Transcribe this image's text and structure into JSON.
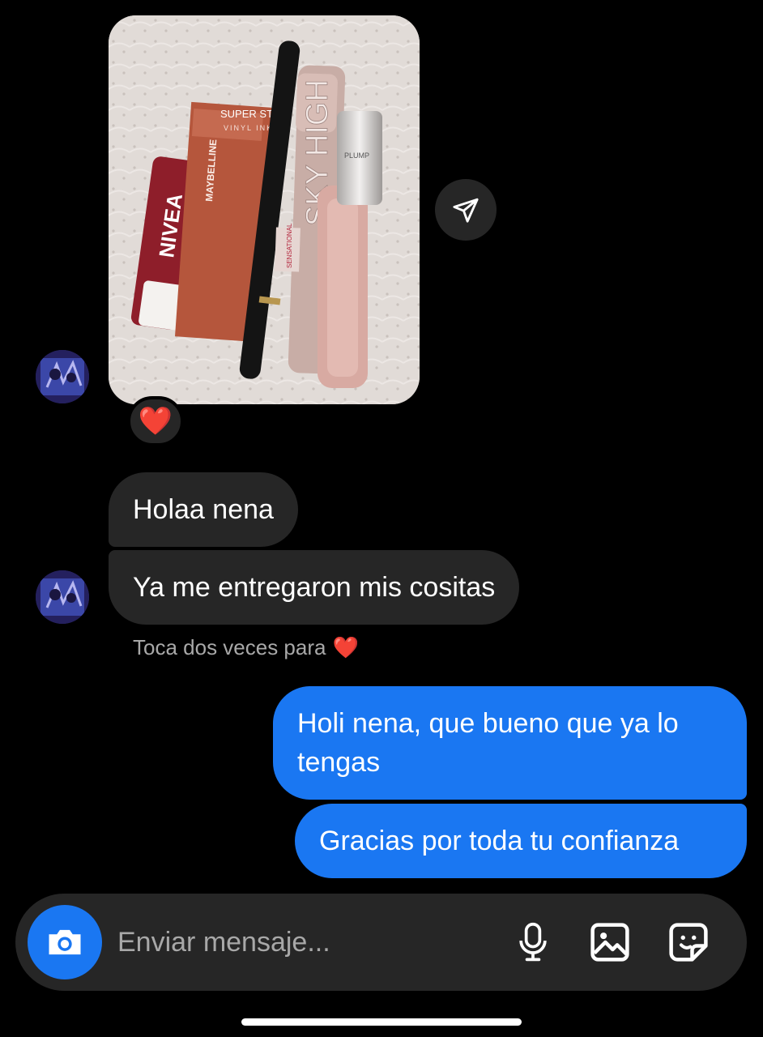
{
  "thread": {
    "photo_message": {
      "image_alt": "Foto de productos de maquillaje",
      "reaction": "❤️",
      "labels": {
        "nivea": "NIVEA",
        "maybelline_top": "SUPER STAY",
        "maybelline_sub": "VINYL INK",
        "maybelline_side": "MAYBELLINE",
        "sky_high": "SKY HIGH",
        "sensational": "SENSATIONAL",
        "gloss": "PLUMP"
      }
    },
    "incoming": [
      {
        "text": "Holaa nena"
      },
      {
        "text": "Ya me entregaron mis cositas"
      }
    ],
    "double_tap_hint": "Toca dos veces para",
    "double_tap_heart": "❤️",
    "outgoing": [
      {
        "text": "Holi nena, que bueno que ya lo tengas"
      },
      {
        "text": "Gracias por toda tu confianza"
      }
    ]
  },
  "composer": {
    "placeholder": "Enviar mensaje...",
    "icons": {
      "camera": "camera-icon",
      "mic": "microphone-icon",
      "gallery": "image-icon",
      "sticker": "sticker-icon"
    }
  },
  "colors": {
    "background": "#000000",
    "incoming_bubble": "#262626",
    "outgoing_bubble": "#1a77f2",
    "hint_text": "#a8a8a8"
  }
}
